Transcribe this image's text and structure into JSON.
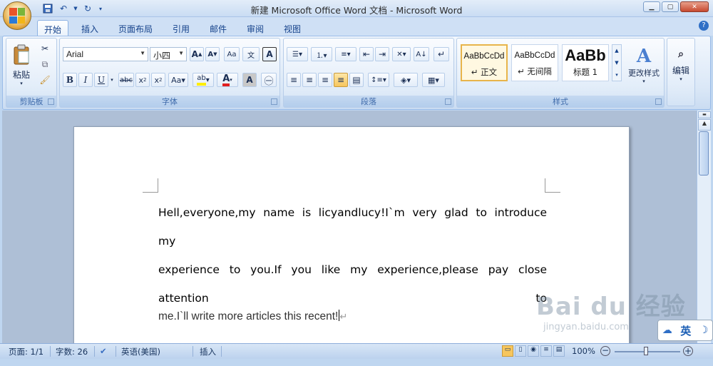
{
  "window": {
    "title": "新建 Microsoft Office Word 文档 - Microsoft Word"
  },
  "tabs": [
    {
      "label": "开始"
    },
    {
      "label": "插入"
    },
    {
      "label": "页面布局"
    },
    {
      "label": "引用"
    },
    {
      "label": "邮件"
    },
    {
      "label": "审阅"
    },
    {
      "label": "视图"
    }
  ],
  "ribbon": {
    "clipboard": {
      "label": "剪贴板",
      "paste": "粘贴"
    },
    "font": {
      "label": "字体",
      "font_name": "Arial",
      "font_size": "小四"
    },
    "paragraph": {
      "label": "段落"
    },
    "styles": {
      "label": "样式",
      "items": [
        {
          "sample": "AaBbCcDd",
          "name": "↵ 正文"
        },
        {
          "sample": "AaBbCcDd",
          "name": "↵ 无间隔"
        },
        {
          "sample": "AaBb",
          "name": "标题 1"
        }
      ],
      "change": "更改样式"
    },
    "editing": {
      "label": "编辑"
    }
  },
  "document": {
    "line1": "Hell,everyone,my  name  is  licyandlucy!I`m  very  glad  to  introduce  my",
    "line2": "experience to you.If you like my experience,please pay close attention to",
    "line3": "me.I`ll write more articles this recent!"
  },
  "status": {
    "page": "页面: 1/1",
    "words": "字数: 26",
    "language": "英语(美国)",
    "mode": "插入",
    "zoom": "100%"
  },
  "watermark": {
    "brand": "Bai du 经验",
    "url": "jingyan.baidu.com"
  },
  "ime": {
    "label": "英"
  },
  "colors": {
    "accent": "#15428b",
    "ribbon_border": "#99bbe8",
    "font_color": "#e02020",
    "highlight": "#ffee00"
  }
}
